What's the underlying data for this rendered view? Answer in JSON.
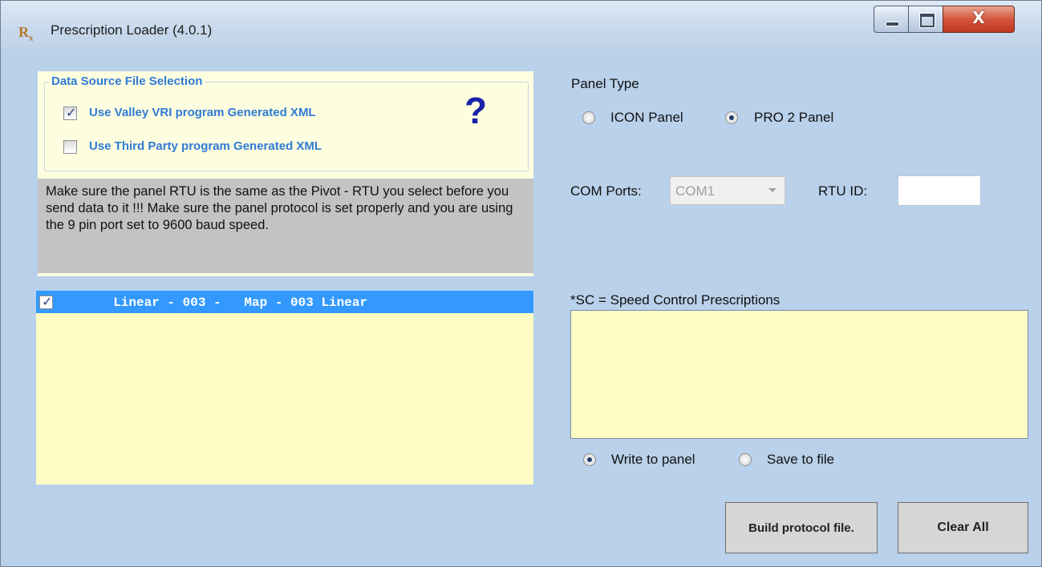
{
  "window": {
    "title": "Prescription Loader (4.0.1)",
    "app_icon": "Rx",
    "controls": {
      "minimize_icon": "minimize-icon",
      "maximize_icon": "maximize-icon",
      "close_glyph": "X"
    }
  },
  "data_source": {
    "legend": "Data Source File Selection",
    "options": [
      {
        "label": "Use Valley VRI program  Generated XML",
        "checked": true
      },
      {
        "label": "Use Third Party program  Generated XML",
        "checked": false
      }
    ],
    "help_glyph": "?"
  },
  "note": "Make sure the panel RTU is the same as the Pivot - RTU you select before you send data to it !!! Make sure the panel protocol is set properly and you are using the 9 pin port set to 9600 baud speed.",
  "prescription_list": {
    "items": [
      {
        "text": "  Linear - 003 -   Map - 003 Linear",
        "checked": true,
        "selected": true
      }
    ]
  },
  "panel_type": {
    "label": "Panel Type",
    "options": [
      {
        "label": "ICON Panel",
        "selected": false
      },
      {
        "label": "PRO 2 Panel",
        "selected": true
      }
    ]
  },
  "com_ports": {
    "label": "COM Ports:",
    "value": "COM1",
    "icon": "chevron-down-icon"
  },
  "rtu_id": {
    "label": "RTU ID:",
    "value": ""
  },
  "sc_section": {
    "label": "*SC = Speed Control Prescriptions"
  },
  "output_mode": {
    "options": [
      {
        "label": "Write to panel",
        "selected": true
      },
      {
        "label": "Save to file",
        "selected": false
      }
    ]
  },
  "buttons": {
    "build": "Build protocol file.",
    "clear": "Clear All"
  },
  "colors": {
    "form_background": "#b9d1ea",
    "group_label": "#2f7bd6",
    "list_background": "#fffdc4",
    "selection": "#3399ff",
    "help_icon": "#1a22a8"
  }
}
